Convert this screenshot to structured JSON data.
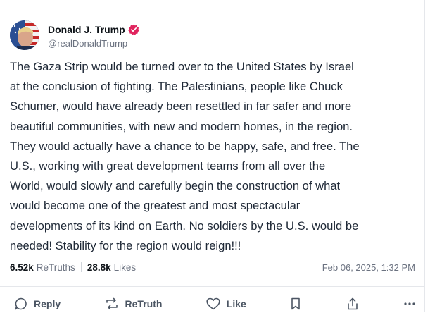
{
  "author": {
    "display_name": "Donald J. Trump",
    "handle": "@realDonaldTrump",
    "verified": true,
    "verified_color": "#e0245e"
  },
  "post": {
    "text": "The Gaza Strip would be turned over to the United States by Israel\nat the conclusion of fighting. The Palestinians, people like Chuck\nSchumer, would have already been resettled in far safer and more\nbeautiful communities, with new and modern homes, in the region.\nThey would actually have a chance to be happy, safe, and free. The\nU.S., working with great development teams from all over the\nWorld, would slowly and carefully begin the construction of what\nwould become one of the greatest and most spectacular\ndevelopments of its kind on Earth. No soldiers by the U.S. would be\nneeded! Stability for the region would reign!!!",
    "retruths_count": "6.52k",
    "retruths_label": "ReTruths",
    "likes_count": "28.8k",
    "likes_label": "Likes",
    "timestamp": "Feb 06, 2025, 1:32 PM"
  },
  "actions": {
    "reply_label": "Reply",
    "retruth_label": "ReTruth",
    "like_label": "Like",
    "icons": [
      "reply-icon",
      "retruth-icon",
      "like-icon",
      "bookmark-icon",
      "share-icon",
      "more-icon"
    ]
  }
}
